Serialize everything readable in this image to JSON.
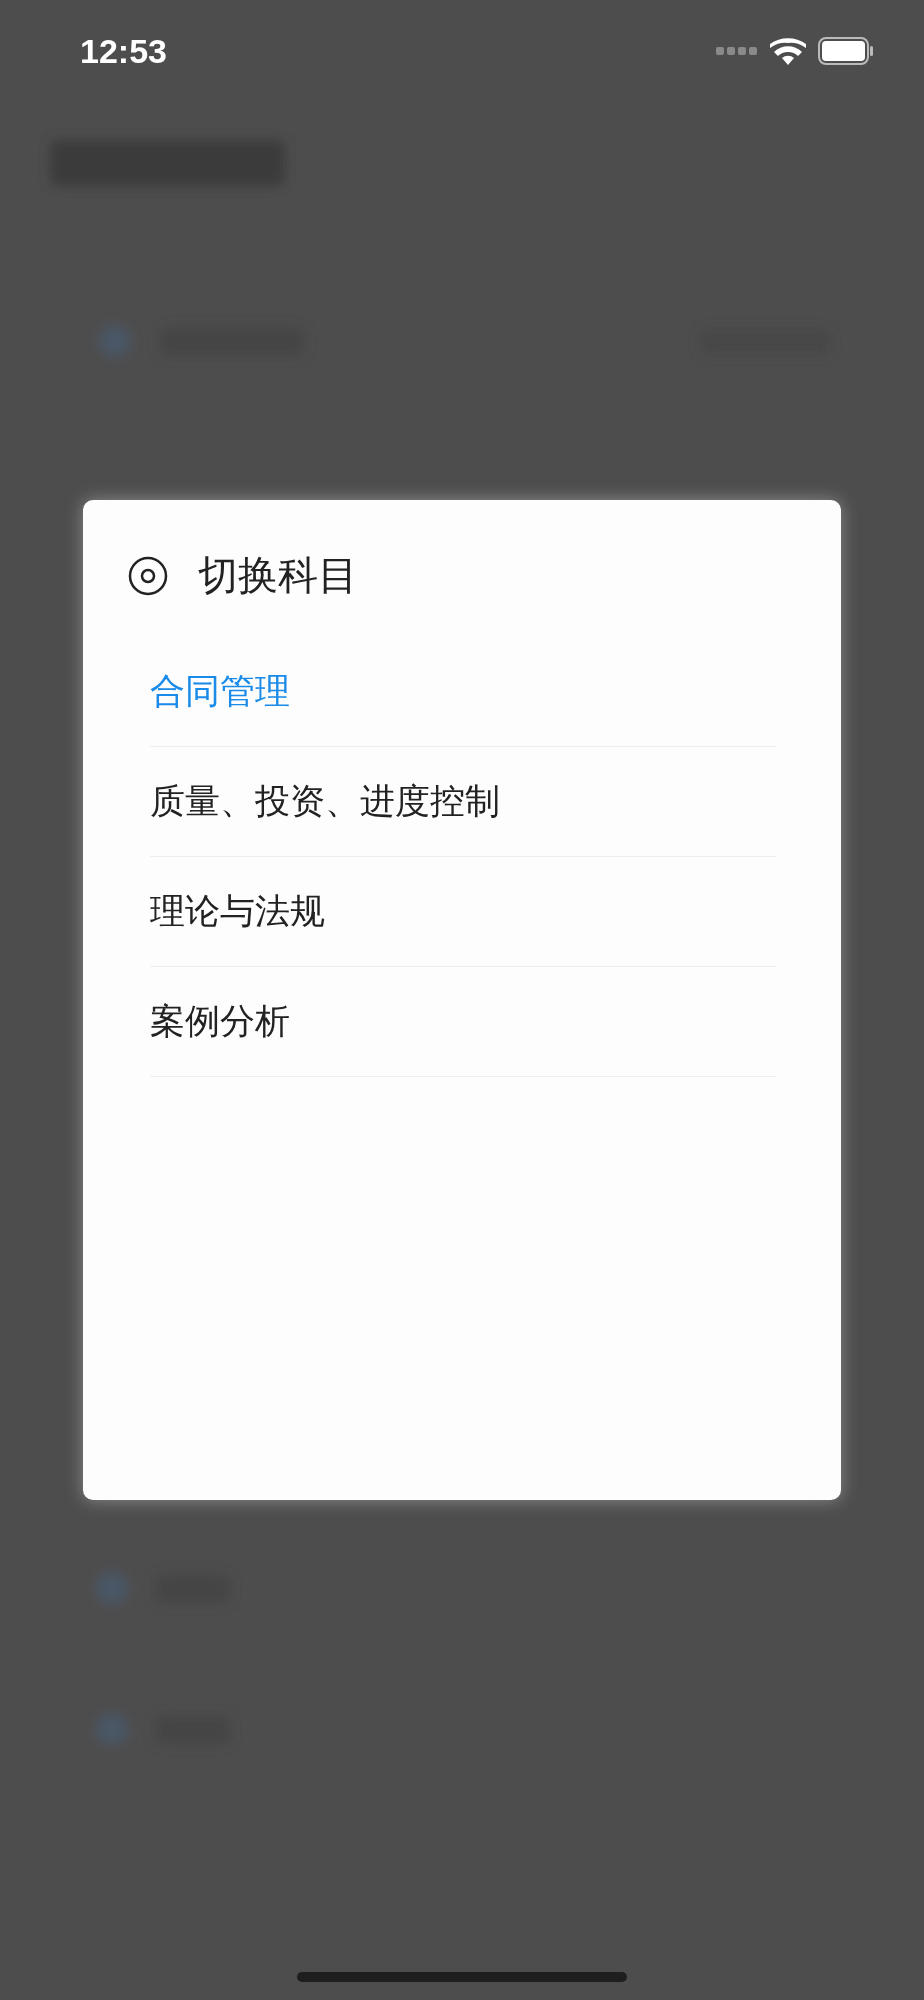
{
  "status_bar": {
    "time": "12:53"
  },
  "dialog": {
    "title": "切换科目",
    "items": [
      {
        "label": "合同管理",
        "selected": true
      },
      {
        "label": "质量、投资、进度控制",
        "selected": false
      },
      {
        "label": "理论与法规",
        "selected": false
      },
      {
        "label": "案例分析",
        "selected": false
      }
    ]
  }
}
